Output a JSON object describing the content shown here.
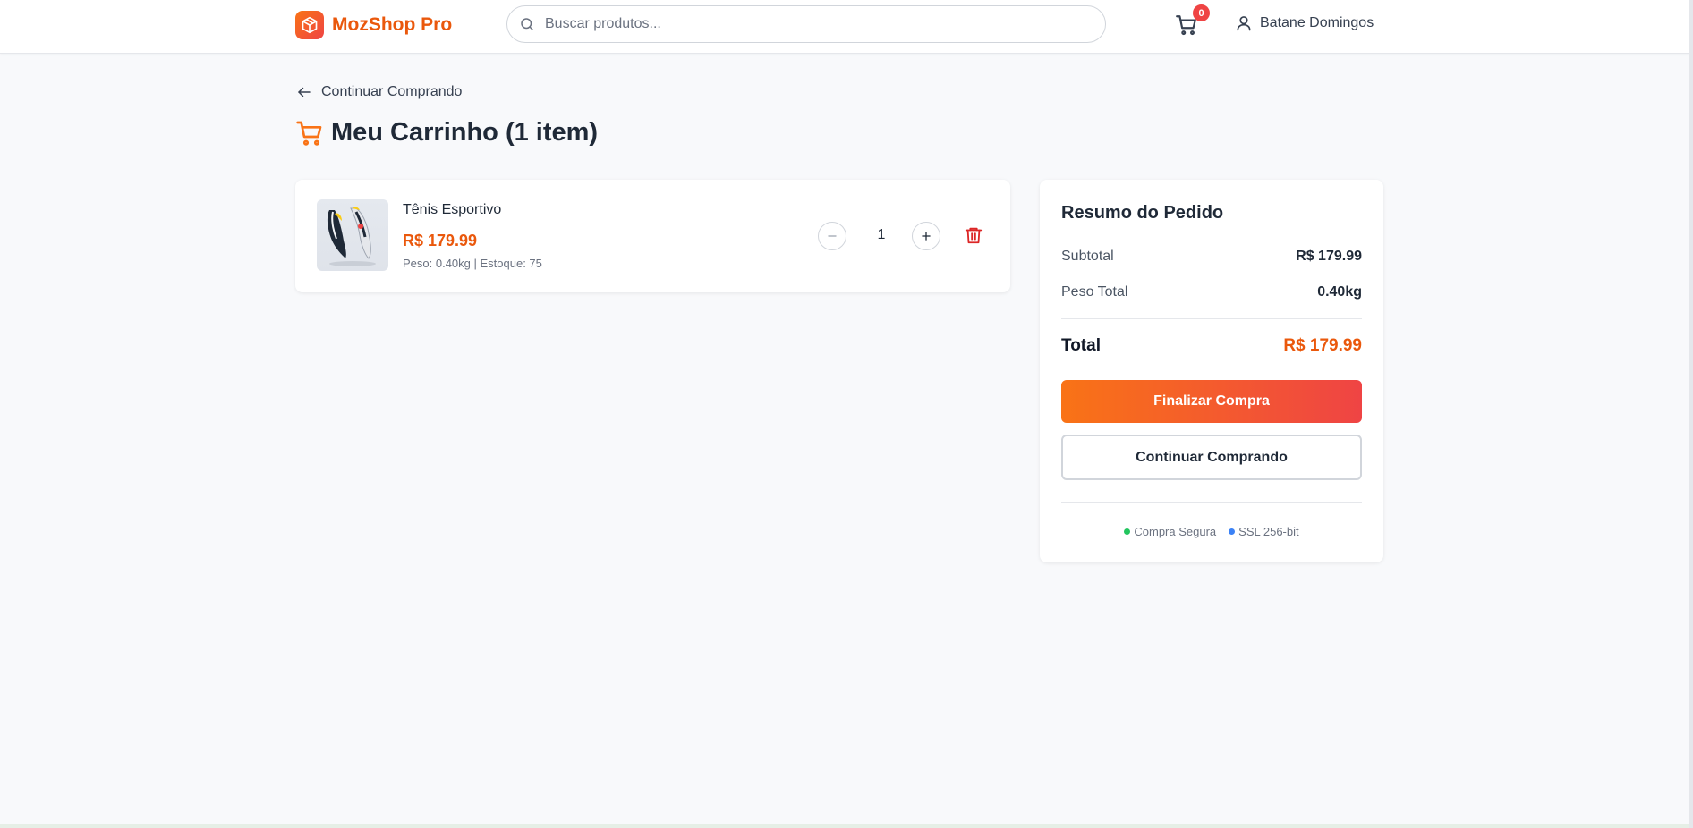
{
  "header": {
    "brand": "MozShop Pro",
    "search_placeholder": "Buscar produtos...",
    "cart_count": "0",
    "user_name": "Batane Domingos"
  },
  "nav": {
    "back_label": "Continuar Comprando"
  },
  "page": {
    "title": "Meu Carrinho (1 item)"
  },
  "cart": {
    "items": [
      {
        "name": "Tênis Esportivo",
        "price": "R$ 179.99",
        "meta": "Peso: 0.40kg | Estoque: 75",
        "quantity": "1",
        "image": "sneaker-image"
      }
    ]
  },
  "summary": {
    "title": "Resumo do Pedido",
    "subtotal_label": "Subtotal",
    "subtotal_value": "R$ 179.99",
    "weight_label": "Peso Total",
    "weight_value": "0.40kg",
    "total_label": "Total",
    "total_value": "R$ 179.99",
    "checkout_label": "Finalizar Compra",
    "continue_label": "Continuar Comprando",
    "badge_secure": "Compra Segura",
    "badge_ssl": "SSL 256-bit"
  },
  "colors": {
    "accent": "#ea580c",
    "gradient_start": "#f97316",
    "gradient_end": "#ef4444",
    "badge_secure_dot": "#22c55e",
    "badge_ssl_dot": "#3b82f6"
  },
  "icons": [
    "package-icon",
    "search-icon",
    "cart-icon",
    "user-icon",
    "arrow-left-icon",
    "shopping-cart-icon",
    "minus-icon",
    "plus-icon",
    "trash-icon"
  ]
}
